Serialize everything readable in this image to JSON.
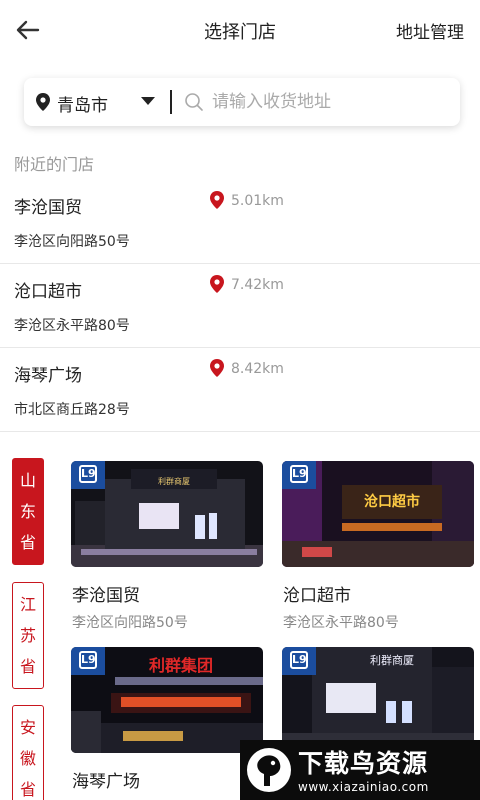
{
  "header": {
    "title": "选择门店",
    "manage_label": "地址管理"
  },
  "search": {
    "city": "青岛市",
    "placeholder": "请输入收货地址"
  },
  "nearby": {
    "title": "附近的门店",
    "stores": [
      {
        "name": "李沧国贸",
        "distance": "5.01km",
        "address": "李沧区向阳路50号"
      },
      {
        "name": "沧口超市",
        "distance": "7.42km",
        "address": "李沧区永平路80号"
      },
      {
        "name": "海琴广场",
        "distance": "8.42km",
        "address": "市北区商丘路28号"
      }
    ]
  },
  "provinces": [
    {
      "label": "山东省",
      "active": true
    },
    {
      "label": "江苏省",
      "active": false
    },
    {
      "label": "安徽省",
      "active": false
    }
  ],
  "store_cards": [
    {
      "name": "李沧国贸",
      "address": "李沧区向阳路50号",
      "sign_text": "利群商厦"
    },
    {
      "name": "沧口超市",
      "address": "李沧区永平路80号",
      "sign_text": "沧口超市"
    },
    {
      "name": "海琴广场",
      "address": "",
      "sign_text": "利群集团"
    },
    {
      "name": "",
      "address": "",
      "sign_text": "利群商厦"
    }
  ],
  "watermark": {
    "title": "下载鸟资源",
    "url": "www.xiazainiao.com"
  },
  "colors": {
    "accent": "#c8161e",
    "badge": "#1b4d9e"
  }
}
